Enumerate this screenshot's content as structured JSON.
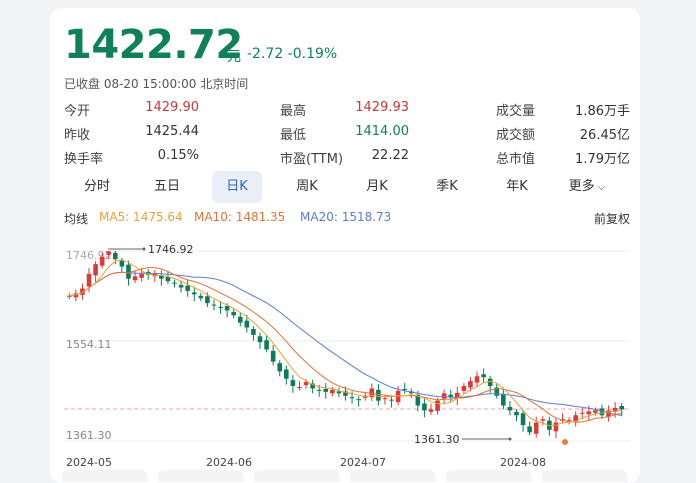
{
  "quote": {
    "price": "1422.72",
    "unit": "元",
    "change": "-2.72",
    "change_pct": "-0.19%",
    "status": "已收盘 08-20 15:00:00 北京时间"
  },
  "stats": [
    [
      {
        "label": "今开",
        "value": "1429.90",
        "tone": "up"
      },
      {
        "label": "最高",
        "value": "1429.93",
        "tone": "up"
      },
      {
        "label": "成交量",
        "value": "1.86万手",
        "tone": "neu"
      }
    ],
    [
      {
        "label": "昨收",
        "value": "1425.44",
        "tone": "neu"
      },
      {
        "label": "最低",
        "value": "1414.00",
        "tone": "dn"
      },
      {
        "label": "成交额",
        "value": "26.45亿",
        "tone": "neu"
      }
    ],
    [
      {
        "label": "换手率",
        "value": "0.15%",
        "tone": "neu"
      },
      {
        "label": "市盈(TTM)",
        "value": "22.22",
        "tone": "neu"
      },
      {
        "label": "总市值",
        "value": "1.79万亿",
        "tone": "neu"
      }
    ]
  ],
  "tabs": [
    "分时",
    "五日",
    "日K",
    "周K",
    "月K",
    "季K",
    "年K",
    "更多"
  ],
  "active_tab": "日K",
  "indicators": {
    "label": "均线",
    "ma5": "MA5: 1475.64",
    "ma10": "MA10: 1481.35",
    "ma20": "MA20: 1518.73",
    "adjust": "前复权"
  },
  "colors": {
    "up": "#d93a3a",
    "down": "#0f7a5a",
    "ma5": "#e8a23b",
    "ma10": "#e0743a",
    "ma20": "#5a7fd0"
  },
  "chart_data": {
    "type": "candlestick",
    "y_ticks": [
      "1746.92",
      "1554.11",
      "1361.30"
    ],
    "ylim": [
      1361.3,
      1746.92
    ],
    "x_ticks": [
      "2024-05",
      "2024-06",
      "2024-07",
      "2024-08"
    ],
    "annotations": {
      "high": "1746.92",
      "low": "1361.30"
    },
    "close": [
      1655,
      1660,
      1670,
      1700,
      1720,
      1735,
      1746,
      1730,
      1715,
      1690,
      1695,
      1700,
      1698,
      1700,
      1690,
      1685,
      1680,
      1672,
      1665,
      1658,
      1650,
      1640,
      1635,
      1630,
      1625,
      1615,
      1600,
      1590,
      1575,
      1560,
      1545,
      1520,
      1500,
      1485,
      1470,
      1468,
      1478,
      1465,
      1460,
      1458,
      1462,
      1455,
      1450,
      1446,
      1442,
      1450,
      1465,
      1440,
      1445,
      1440,
      1460,
      1462,
      1455,
      1430,
      1420,
      1422,
      1440,
      1455,
      1448,
      1456,
      1470,
      1480,
      1490,
      1488,
      1470,
      1450,
      1430,
      1420,
      1410,
      1390,
      1375,
      1395,
      1402,
      1380,
      1395,
      1402,
      1400,
      1410,
      1415,
      1418,
      1420,
      1410,
      1420,
      1425,
      1422
    ]
  }
}
